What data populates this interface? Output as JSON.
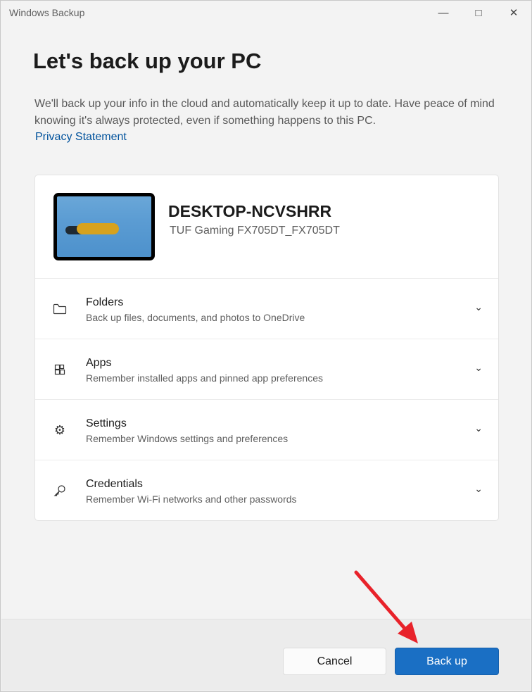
{
  "window": {
    "title": "Windows Backup",
    "controls": [
      "minimize",
      "maximize",
      "close"
    ]
  },
  "page": {
    "title": "Let's back up your PC",
    "description": "We'll back up your info in the cloud and automatically keep it up to date. Have peace of mind knowing it's always protected, even if something happens to this PC.",
    "privacy_link": "Privacy Statement"
  },
  "device": {
    "name": "DESKTOP-NCVSHRR",
    "model": "TUF Gaming FX705DT_FX705DT"
  },
  "items": [
    {
      "title": "Folders",
      "subtitle": "Back up files, documents, and photos to OneDrive",
      "icon": "folder-icon"
    },
    {
      "title": "Apps",
      "subtitle": "Remember installed apps and pinned app preferences",
      "icon": "apps-icon"
    },
    {
      "title": "Settings",
      "subtitle": "Remember Windows settings and preferences",
      "icon": "gear-icon"
    },
    {
      "title": "Credentials",
      "subtitle": "Remember Wi-Fi networks and other passwords",
      "icon": "key-icon"
    }
  ],
  "buttons": {
    "cancel": "Cancel",
    "backup": "Back up"
  },
  "colors": {
    "accent": "#1a6fc4",
    "link": "#00529c",
    "annotation_arrow": "#e8222a"
  }
}
